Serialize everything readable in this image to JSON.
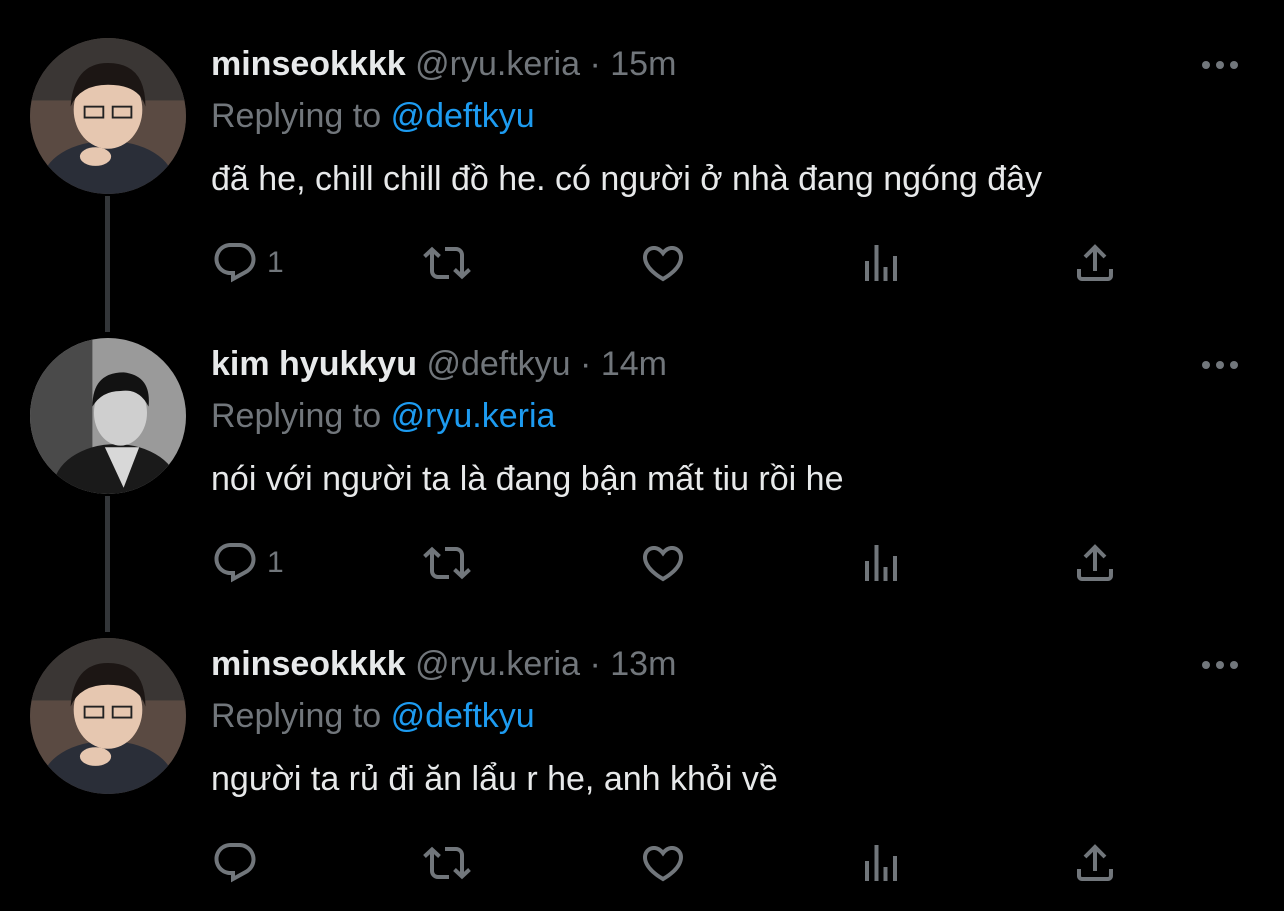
{
  "colors": {
    "background": "#000000",
    "name": "#e7e9ea",
    "muted": "#71767b",
    "mention": "#1d9bf0",
    "thread_line": "#333639"
  },
  "tweets": [
    {
      "name": "minseokkkk",
      "handle": "@ryu.keria",
      "dot": "·",
      "time": "15m",
      "replying_prefix": "Replying to",
      "replying_to": "@deftkyu",
      "text": "đã he, chill chill đồ he. có người ở nhà đang ngóng đây",
      "reply_count": "1",
      "avatar": "avatar-minseok"
    },
    {
      "name": "kim hyukkyu",
      "handle": "@deftkyu",
      "dot": "·",
      "time": "14m",
      "replying_prefix": "Replying to",
      "replying_to": "@ryu.keria",
      "text": "nói với người ta là đang bận mất tiu rồi he",
      "reply_count": "1",
      "avatar": "avatar-hyukkyu"
    },
    {
      "name": "minseokkkk",
      "handle": "@ryu.keria",
      "dot": "·",
      "time": "13m",
      "replying_prefix": "Replying to",
      "replying_to": "@deftkyu",
      "text": "người ta rủ đi ăn lẩu r he, anh khỏi về",
      "reply_count": "",
      "avatar": "avatar-minseok"
    }
  ],
  "icons": [
    "reply-icon",
    "retweet-icon",
    "like-icon",
    "views-icon",
    "share-icon",
    "more-icon"
  ]
}
